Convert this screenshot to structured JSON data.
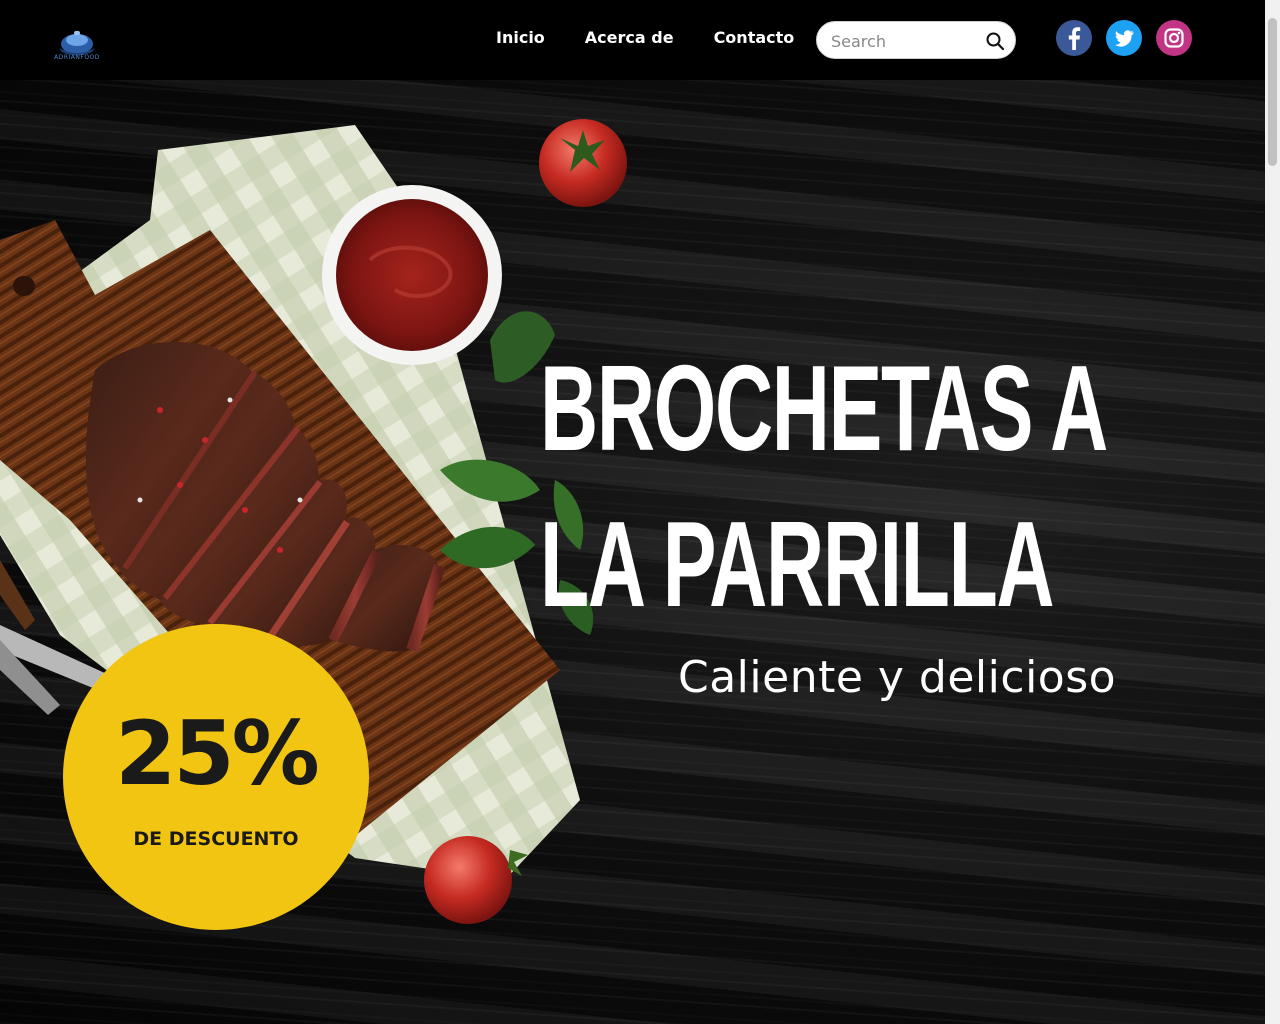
{
  "header": {
    "logo_text": "ADRIANFOOD",
    "nav": [
      {
        "label": "Inicio"
      },
      {
        "label": "Acerca de"
      },
      {
        "label": "Contacto"
      }
    ],
    "search": {
      "placeholder": "Search",
      "value": ""
    },
    "social": [
      {
        "icon": "facebook-icon",
        "color": "#3b5998"
      },
      {
        "icon": "twitter-icon",
        "color": "#1da1f2"
      },
      {
        "icon": "instagram-icon",
        "color": "#c13584"
      }
    ]
  },
  "hero": {
    "title_line1": "BROCHETAS A",
    "title_line2": "LA PARRILLA",
    "subtitle": "Caliente y delicioso",
    "discount": {
      "value": "25%",
      "label": "DE DESCUENTO",
      "color": "#f2c512"
    }
  }
}
